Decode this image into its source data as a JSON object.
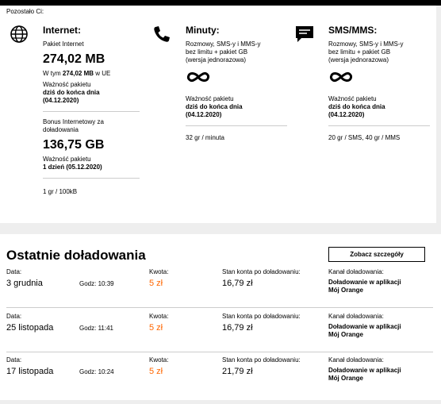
{
  "header": {
    "remaining_label": "Pozostało Ci:"
  },
  "internet": {
    "title": "Internet:",
    "package_label": "Pakiet Internet",
    "package_amount": "274,02 MB",
    "eu_prefix": "W tym",
    "eu_amount": "274,02 MB",
    "eu_suffix": "w UE",
    "validity_label": "Ważność pakietu",
    "validity_value": "dziś do końca dnia",
    "validity_date": "(04.12.2020)",
    "bonus_label_1": "Bonus Internetowy za",
    "bonus_label_2": "doładowania",
    "bonus_amount": "136,75 GB",
    "bonus_validity_label": "Ważność pakietu",
    "bonus_validity_value": "1 dzień (05.12.2020)",
    "price": "1 gr / 100kB"
  },
  "minutes": {
    "title": "Minuty:",
    "desc_1": "Rozmowy, SMS-y i MMS-y",
    "desc_2": "bez limitu + pakiet GB",
    "desc_3": "(wersja jednorazowa)",
    "validity_label": "Ważność pakietu",
    "validity_value": "dziś do końca dnia",
    "validity_date": "(04.12.2020)",
    "price": "32 gr / minuta"
  },
  "sms": {
    "title": "SMS/MMS:",
    "desc_1": "Rozmowy, SMS-y i MMS-y",
    "desc_2": "bez limitu + pakiet GB",
    "desc_3": "(wersja jednorazowa)",
    "validity_label": "Ważność pakietu",
    "validity_value": "dziś do końca dnia",
    "validity_date": "(04.12.2020)",
    "price": "20 gr / SMS, 40 gr / MMS"
  },
  "topups": {
    "title": "Ostatnie doładowania",
    "details_button": "Zobacz szczegóły",
    "labels": {
      "date": "Data:",
      "amount": "Kwota:",
      "balance": "Stan konta po doładowaniu:",
      "channel": "Kanał doładowania:"
    },
    "rows": [
      {
        "date": "3 grudnia",
        "time": "Godz: 10:39",
        "amount": "5 zł",
        "balance": "16,79 zł",
        "channel_1": "Doładowanie w aplikacji",
        "channel_2": "Mój Orange"
      },
      {
        "date": "25 listopada",
        "time": "Godz: 11:41",
        "amount": "5 zł",
        "balance": "16,79 zł",
        "channel_1": "Doładowanie w aplikacji",
        "channel_2": "Mój Orange"
      },
      {
        "date": "17 listopada",
        "time": "Godz: 10:24",
        "amount": "5 zł",
        "balance": "21,79 zł",
        "channel_1": "Doładowanie w aplikacji",
        "channel_2": "Mój Orange"
      }
    ]
  },
  "colors": {
    "accent": "#ff6600",
    "background": "#eeeeee",
    "panel": "#ffffff"
  },
  "icons": [
    "globe-icon",
    "phone-icon",
    "chat-icon",
    "infinity-icon"
  ]
}
